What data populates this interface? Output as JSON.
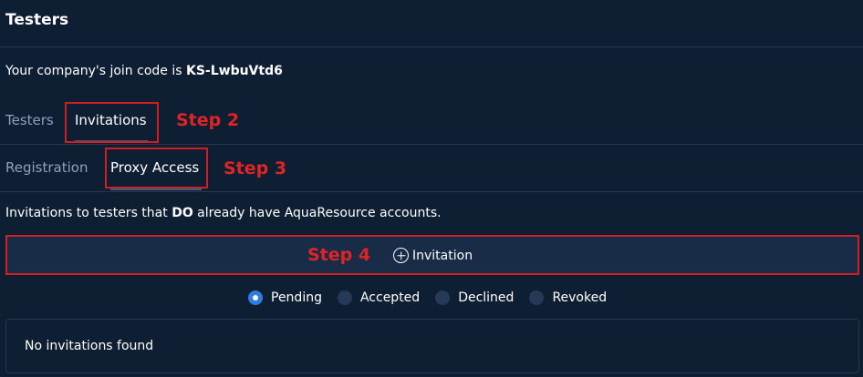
{
  "page": {
    "title": "Testers",
    "join_code_prefix": "Your company's join code is ",
    "join_code": "KS-LwbuVtd6"
  },
  "tabs_row1": [
    {
      "label": "Testers",
      "active": false
    },
    {
      "label": "Invitations",
      "active": true
    }
  ],
  "tabs_row2": [
    {
      "label": "Registration",
      "active": false
    },
    {
      "label": "Proxy Access",
      "active": true
    }
  ],
  "annotations": {
    "step2": "Step 2",
    "step3": "Step 3",
    "step4": "Step 4"
  },
  "description": {
    "before": "Invitations to testers that ",
    "bold": "DO",
    "after": " already have AquaResource accounts."
  },
  "invitation_button": {
    "label": "Invitation",
    "icon": "plus-circle-icon"
  },
  "filters": [
    {
      "label": "Pending",
      "selected": true
    },
    {
      "label": "Accepted",
      "selected": false
    },
    {
      "label": "Declined",
      "selected": false
    },
    {
      "label": "Revoked",
      "selected": false
    }
  ],
  "empty_state": "No invitations found",
  "colors": {
    "background": "#0f1f33",
    "annotation_red": "#e02424",
    "radio_selected": "#2f7de1",
    "tab_inactive": "#8ea2bd"
  }
}
